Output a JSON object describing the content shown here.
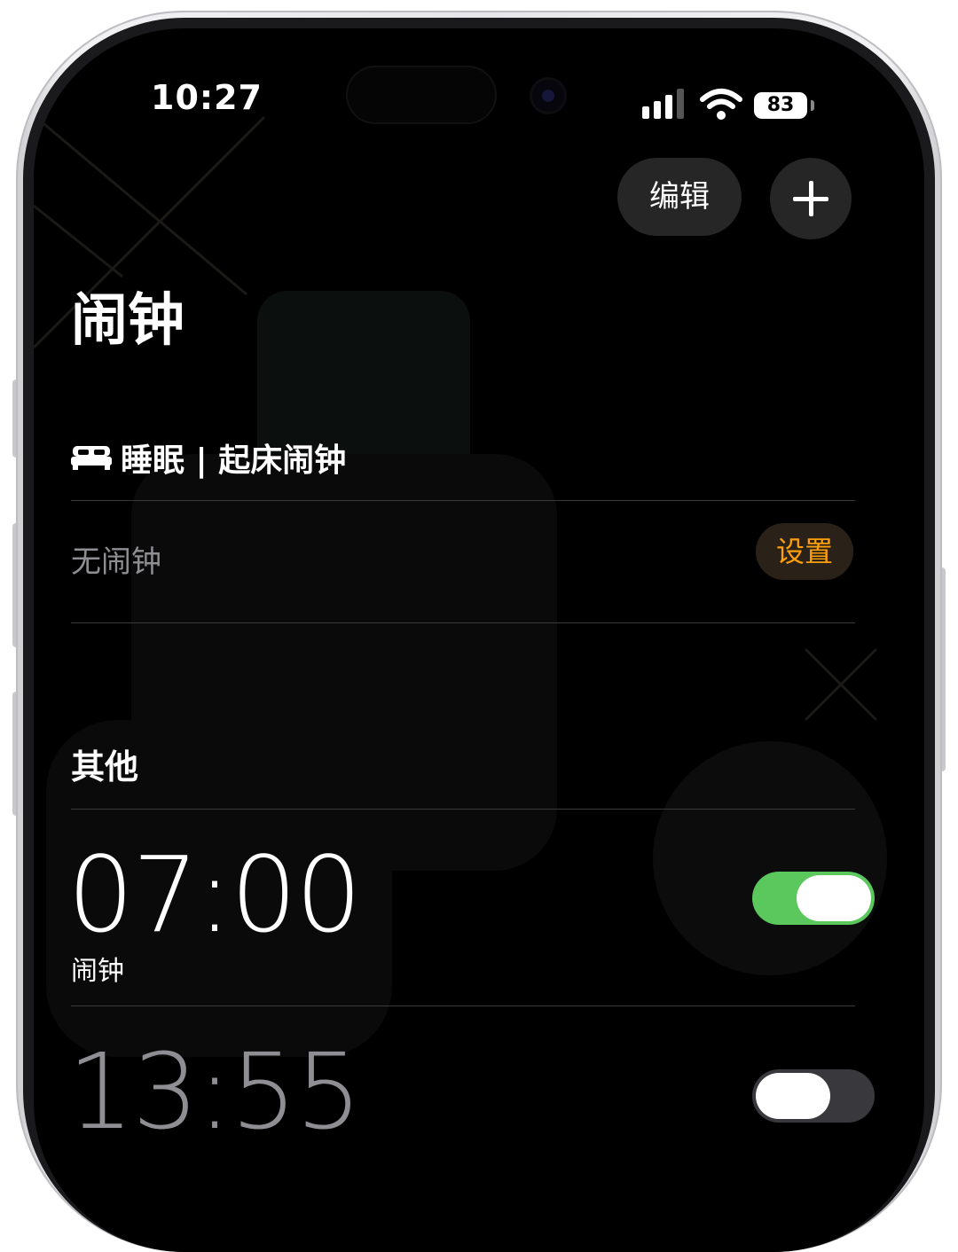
{
  "status_bar": {
    "time": "10:27",
    "battery": "83"
  },
  "toolbar": {
    "edit_label": "编辑",
    "add_icon": "plus-icon"
  },
  "page": {
    "title": "闹钟"
  },
  "sleep_section": {
    "icon": "bed-icon",
    "title": "睡眠 | 起床闹钟",
    "empty_text": "无闹钟",
    "set_label": "设置",
    "accent": "#ff9f0a"
  },
  "other_section": {
    "title": "其他",
    "alarms": [
      {
        "time": "07:00",
        "label": "闹钟",
        "enabled": true
      },
      {
        "time": "13:55",
        "label": "",
        "enabled": false
      }
    ]
  },
  "colors": {
    "background": "#000000",
    "toggle_on": "#5ac85c",
    "toggle_off": "#39393d"
  }
}
